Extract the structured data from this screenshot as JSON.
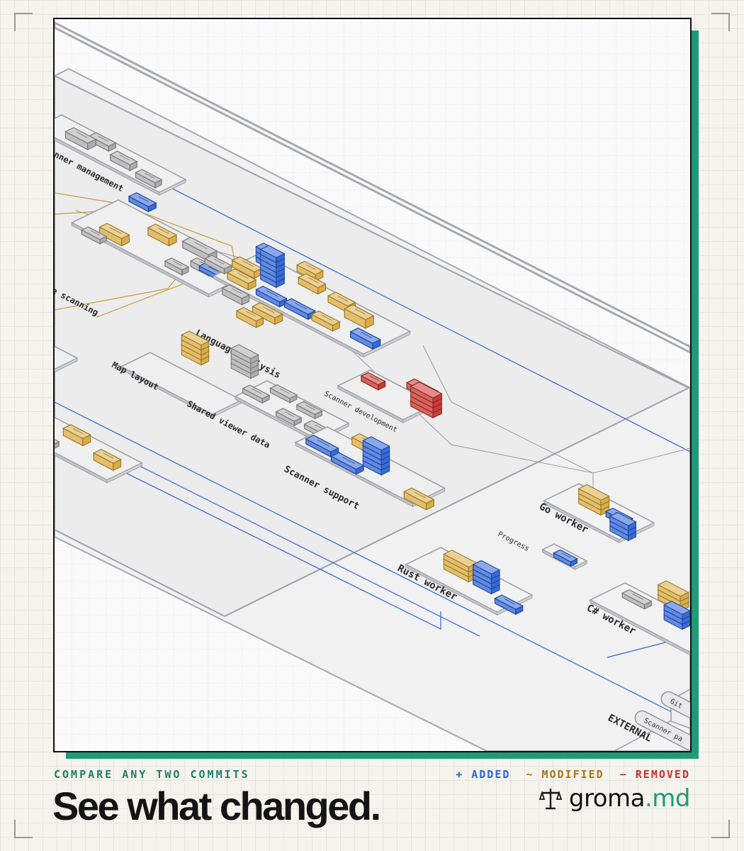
{
  "footer": {
    "tagline": "COMPARE ANY TWO COMMITS",
    "headline": "See what changed.",
    "legend": [
      {
        "label": "+ ADDED",
        "color": "#2c63d8"
      },
      {
        "label": "~ MODIFIED",
        "color": "#a8741a"
      },
      {
        "label": "− REMOVED",
        "color": "#c8322b"
      }
    ],
    "brand": {
      "name": "groma",
      "suffix": ".md",
      "icon": "scale-icon"
    }
  },
  "diagram": {
    "colors": {
      "added": "#2c63d8",
      "modified": "#d9a93c",
      "removed": "#c8322b",
      "unchanged": "#a9a9a9"
    },
    "groups": [
      {
        "label": "anner management"
      },
      {
        "label": "e scanning"
      },
      {
        "label": "Language analysis"
      },
      {
        "label": "Map layout"
      },
      {
        "label": "Scanner development"
      },
      {
        "label": "Shared viewer data"
      },
      {
        "label": "Scanner support"
      },
      {
        "label": "Go worker"
      },
      {
        "label": "Progress"
      },
      {
        "label": "Rust worker"
      },
      {
        "label": "C# worker"
      },
      {
        "label": "EXTERNAL"
      }
    ],
    "external": [
      {
        "label": "Git"
      },
      {
        "label": "Scanner pa"
      }
    ]
  }
}
